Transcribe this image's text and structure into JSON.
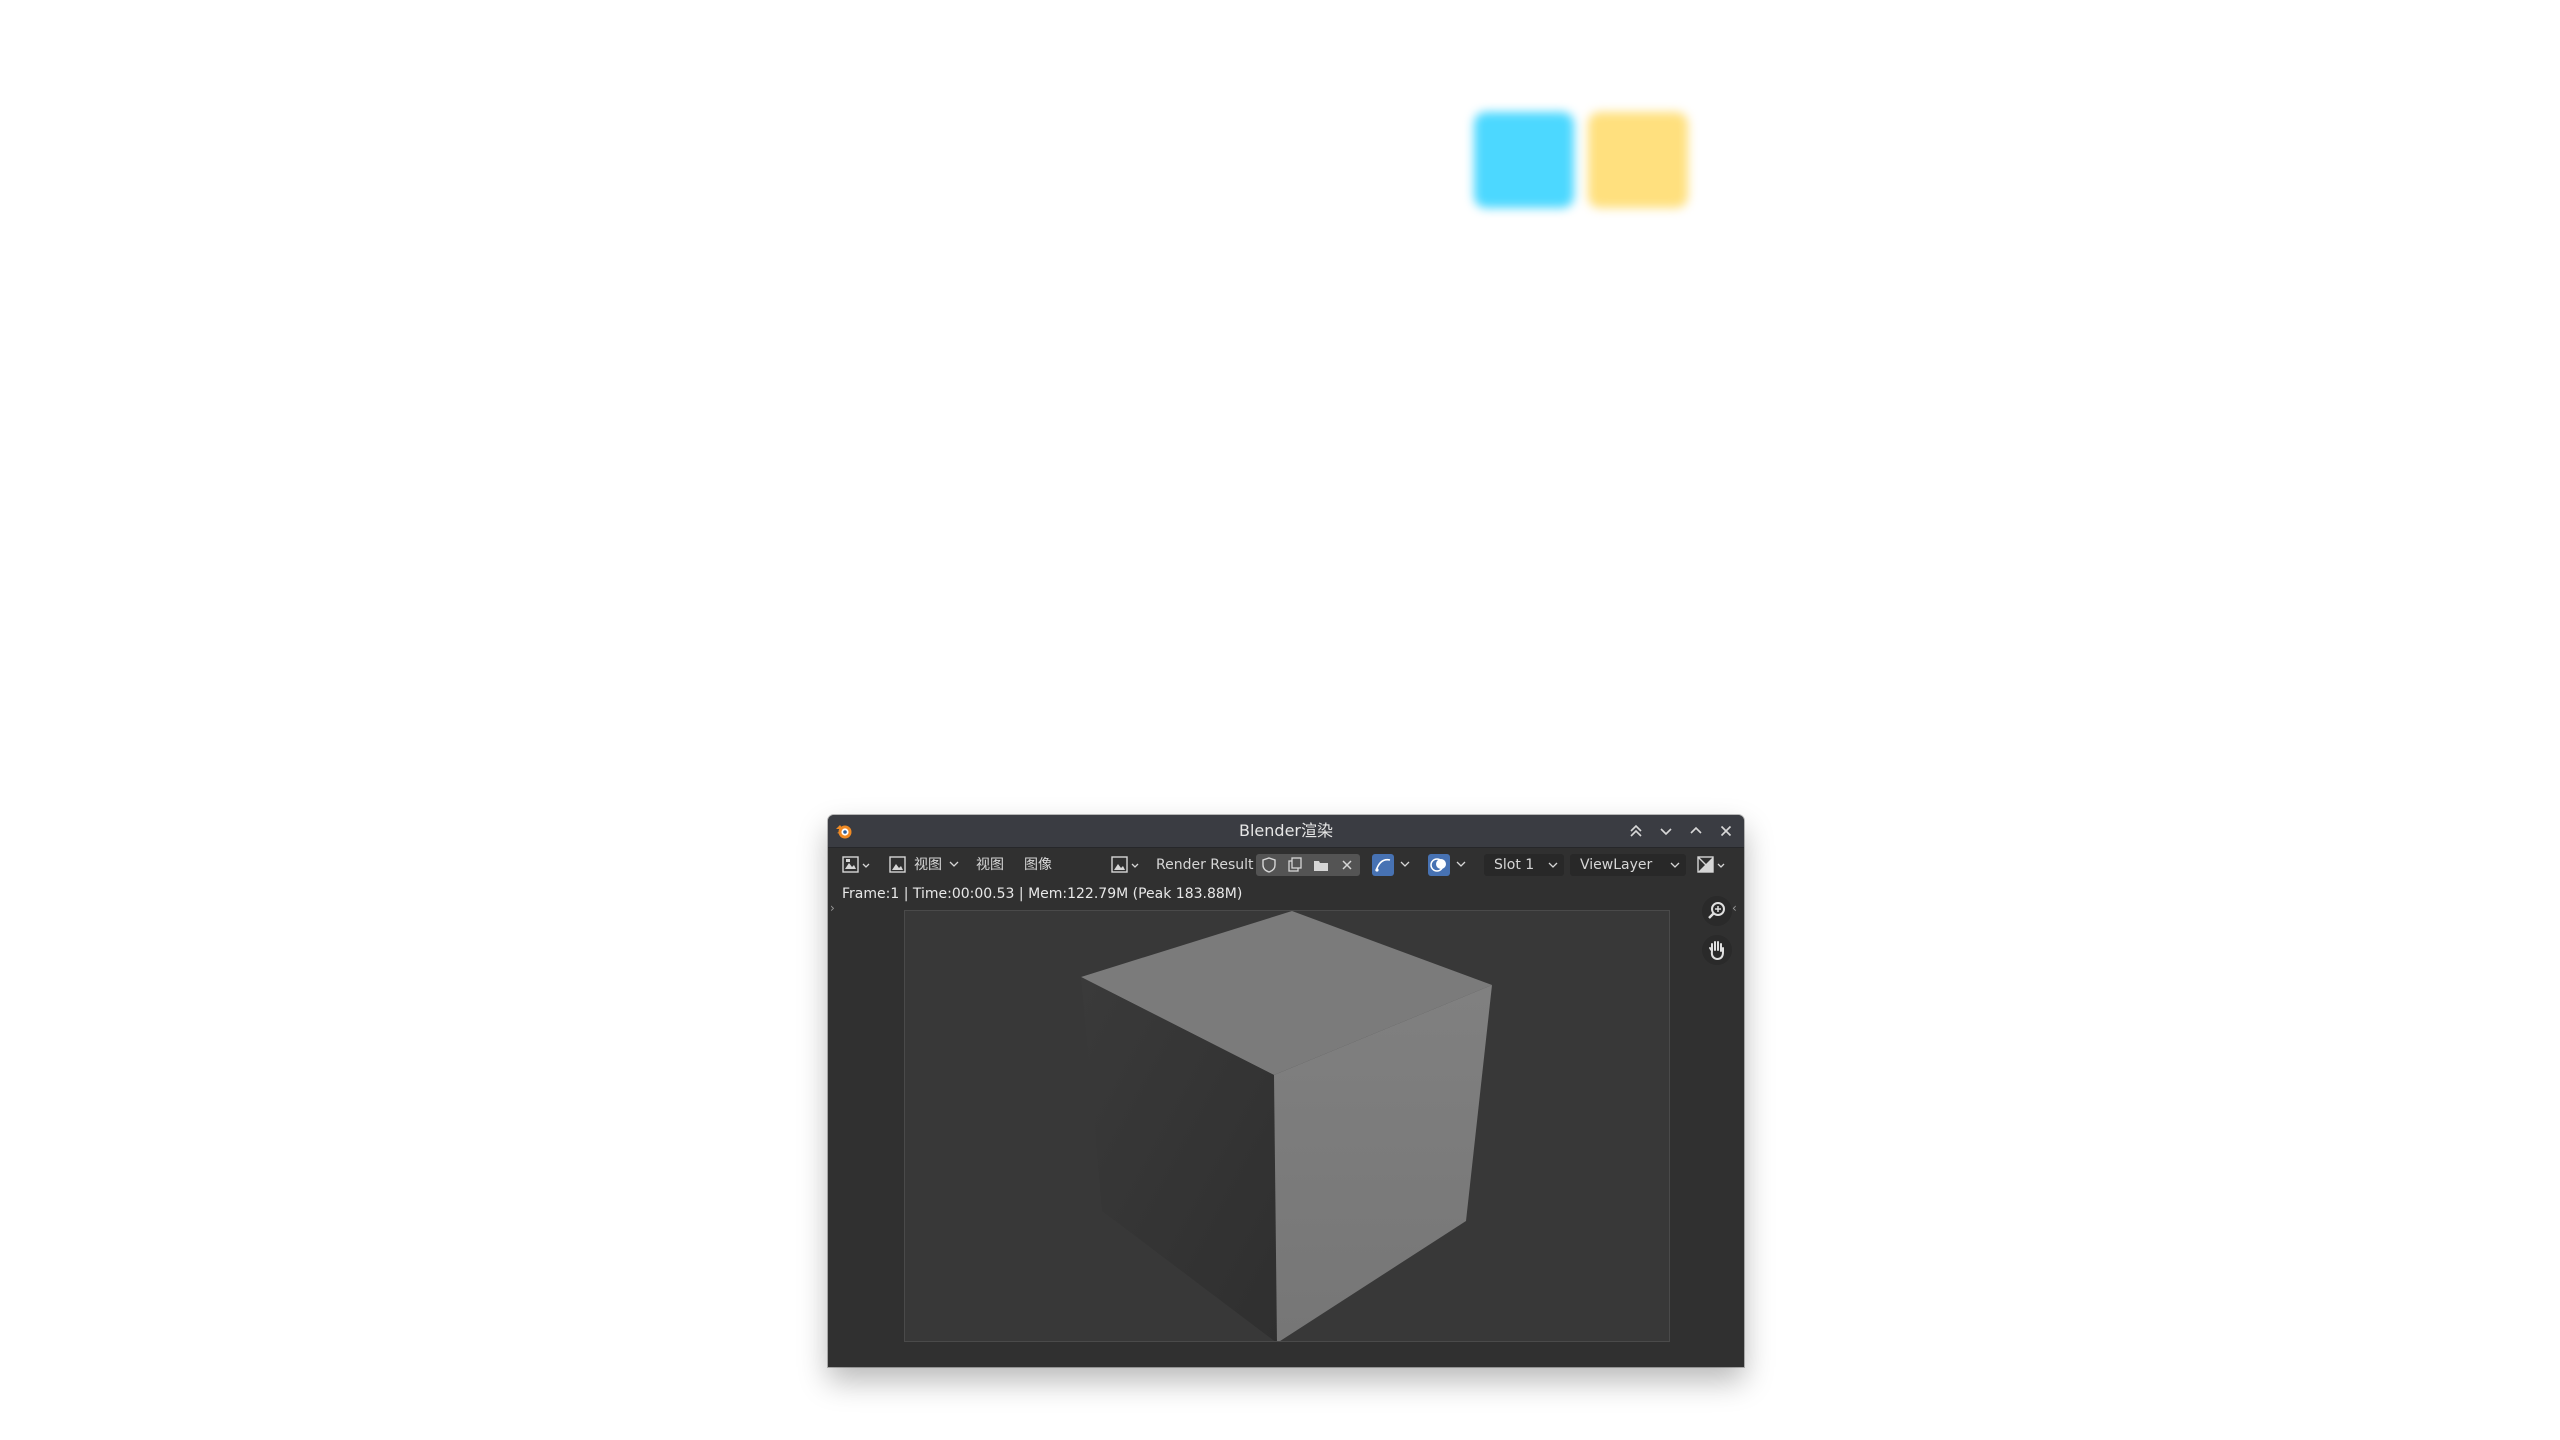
{
  "window": {
    "title": "Blender渲染",
    "controls": [
      "minimize-all-icon",
      "chevron-down-icon",
      "chevron-up-icon",
      "close-icon"
    ]
  },
  "toolbar": {
    "editor_type_icon": "image-editor-icon",
    "view_menu_1": "视图",
    "view_menu_2": "视图",
    "image_menu": "图像",
    "image_name": "Render Result",
    "slot": "Slot 1",
    "view_layer": "ViewLayer"
  },
  "info": {
    "text": "Frame:1 | Time:00:00.53 | Mem:122.79M (Peak 183.88M)"
  },
  "colors": {
    "accent_blue": "#4772b3",
    "window_bg": "#303030",
    "titlebar_bg": "#3a3c42",
    "desktop_cyan": "#4cd8ff",
    "desktop_yellow": "#ffe07e"
  },
  "viewport_tools": [
    "zoom-icon",
    "hand-pan-icon"
  ]
}
